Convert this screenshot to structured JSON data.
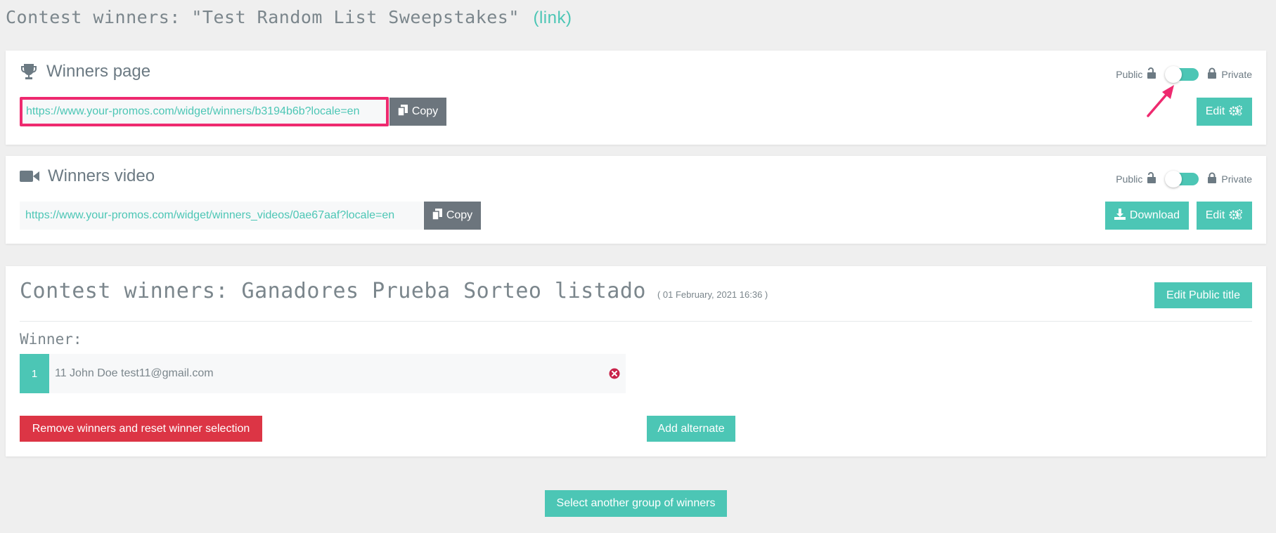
{
  "header": {
    "title": "Contest winners: \"Test Random List Sweepstakes\"",
    "link_text": "(link)"
  },
  "winners_page": {
    "title": "Winners page",
    "url": "https://www.your-promos.com/widget/winners/b3194b6b?locale=en",
    "copy_label": "Copy",
    "public_label": "Public",
    "private_label": "Private",
    "edit_label": "Edit"
  },
  "winners_video": {
    "title": "Winners video",
    "url": "https://www.your-promos.com/widget/winners_videos/0ae67aaf?locale=en",
    "copy_label": "Copy",
    "public_label": "Public",
    "private_label": "Private",
    "download_label": "Download",
    "edit_label": "Edit"
  },
  "contest": {
    "title": "Contest winners: Ganadores Prueba Sorteo listado",
    "date": "( 01 February, 2021 16:36 )",
    "edit_title_label": "Edit Public title",
    "winner_label": "Winner:",
    "winners": [
      {
        "number": "1",
        "text": "11 John Doe test11@gmail.com"
      }
    ],
    "remove_label": "Remove winners and reset winner selection",
    "add_alternate_label": "Add alternate"
  },
  "footer": {
    "select_another_label": "Select another group of winners"
  },
  "colors": {
    "accent": "#4cc6b5",
    "danger": "#dc3545",
    "highlight": "#ee2a6f",
    "secondary": "#6c757d"
  },
  "icons": [
    "trophy-icon",
    "video-camera-icon",
    "copy-icon",
    "unlock-icon",
    "lock-icon",
    "cogs-icon",
    "download-icon",
    "remove-circle-icon",
    "pointer-arrow"
  ]
}
